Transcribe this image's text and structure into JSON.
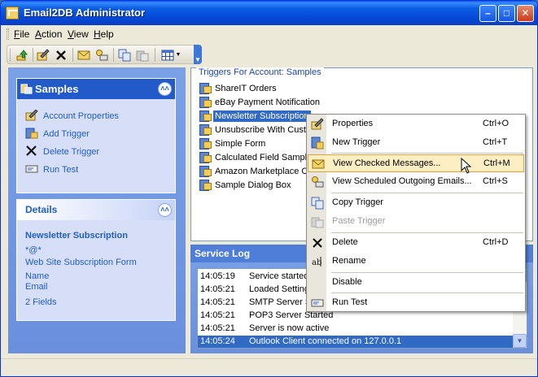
{
  "window": {
    "title": "Email2DB Administrator"
  },
  "menu": [
    {
      "label": "File",
      "key": "F",
      "rest": "ile"
    },
    {
      "label": "Action",
      "key": "A",
      "rest": "ction"
    },
    {
      "label": "View",
      "key": "V",
      "rest": "iew"
    },
    {
      "label": "Help",
      "key": "H",
      "rest": "elp"
    }
  ],
  "samples": {
    "title": "Samples",
    "tasks": [
      "Account Properties",
      "Add Trigger",
      "Delete Trigger",
      "Run Test"
    ]
  },
  "details": {
    "title": "Details",
    "name": "Newsletter Subscription",
    "pattern": "*@*",
    "source": "Web Site Subscription Form",
    "fields": [
      "Name",
      "Email"
    ],
    "field_count": "2 Fields"
  },
  "triggers": {
    "title": "Triggers For Account: Samples",
    "items": [
      "ShareIT Orders",
      "eBay Payment Notification",
      "Newsletter Subscription",
      "Unsubscribe With Custo",
      "Simple Form",
      "Calculated Field Sample",
      "Amazon Marketplace Or",
      "Sample Dialog Box"
    ],
    "selected_index": 2
  },
  "service_log": {
    "title": "Service Log",
    "rows": [
      {
        "time": "14:05:19",
        "msg": "Service started"
      },
      {
        "time": "14:05:21",
        "msg": "Loaded Setting"
      },
      {
        "time": "14:05:21",
        "msg": "SMTP Server S"
      },
      {
        "time": "14:05:21",
        "msg": "POP3 Server Started"
      },
      {
        "time": "14:05:21",
        "msg": "Server is now active"
      },
      {
        "time": "14:05:24",
        "msg": "Outlook Client connected on 127.0.0.1"
      }
    ]
  },
  "context_menu": {
    "items": [
      {
        "label": "Properties",
        "shortcut": "Ctrl+O"
      },
      {
        "label": "New Trigger",
        "shortcut": "Ctrl+T"
      },
      {
        "label": "View Checked Messages...",
        "shortcut": "Ctrl+M"
      },
      {
        "label": "View Scheduled Outgoing Emails...",
        "shortcut": "Ctrl+S"
      },
      {
        "label": "Copy Trigger",
        "shortcut": ""
      },
      {
        "label": "Paste Trigger",
        "shortcut": ""
      },
      {
        "label": "Delete",
        "shortcut": "Ctrl+D"
      },
      {
        "label": "Rename",
        "shortcut": ""
      },
      {
        "label": "Disable",
        "shortcut": ""
      },
      {
        "label": "Run Test",
        "shortcut": ""
      }
    ],
    "highlighted_index": 2,
    "disabled_index": 5
  },
  "icons": {
    "minimize": "minimize-icon",
    "maximize": "maximize-icon",
    "close": "close-icon"
  }
}
